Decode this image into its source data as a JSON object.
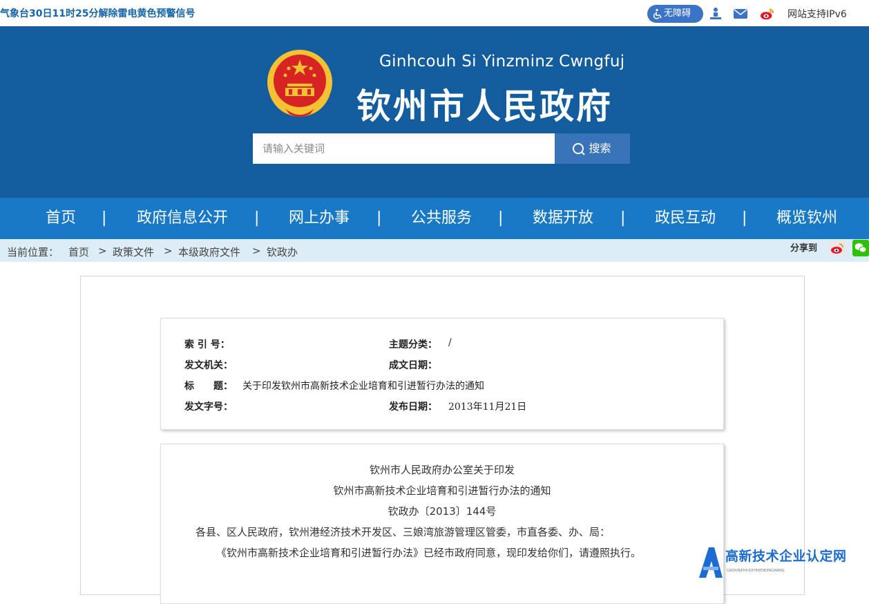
{
  "topbar": {
    "notice": "气象台30日11时25分解除雷电黄色预警信号",
    "accessibility_label": "无障碍",
    "ipv6_label": "网站支持IPv6"
  },
  "header": {
    "pinyin_title": "Ginhcouh Si Yinzminz Cwngfuj",
    "cn_title": "钦州市人民政府",
    "search_placeholder": "请输入关键词",
    "search_button": "搜索"
  },
  "nav": {
    "items": [
      "首页",
      "政府信息公开",
      "网上办事",
      "公共服务",
      "数据开放",
      "政民互动",
      "概览钦州"
    ],
    "separator": "|"
  },
  "breadcrumb": {
    "label": "当前位置：",
    "items": [
      "首页",
      "政策文件",
      "本级政府文件",
      "钦政办"
    ],
    "separator": ">",
    "share_label": "分享到"
  },
  "meta": {
    "index_label": "索 引 号：",
    "index_value": "",
    "topic_label": "主题分类：",
    "topic_value": "/",
    "issuer_label": "发文机关：",
    "issuer_value": "",
    "written_label": "成文日期：",
    "written_value": "",
    "title_label": "标　　题：",
    "title_value": "关于印发钦州市高新技术企业培育和引进暂行办法的通知",
    "docno_label": "发文字号：",
    "docno_value": "",
    "publish_label": "发布日期：",
    "publish_value": "2013年11月21日"
  },
  "document": {
    "heading_line1": "钦州市人民政府办公室关于印发",
    "heading_line2": "钦州市高新技术企业培育和引进暂行办法的通知",
    "doc_number": "钦政办〔2013〕144号",
    "recipients": "各县、区人民政府，钦州港经济技术开发区、三娘湾旅游管理区管委，市直各委、办、局：",
    "paragraph1": "《钦州市高新技术企业培育和引进暂行办法》已经市政府同意，现印发给你们，请遵照执行。"
  },
  "watermark": {
    "text": "高新技术企业认定网",
    "subtext": "GAOXINJISHUQIYERENDINGWANG"
  },
  "colors": {
    "header_bg": "#135c9d",
    "nav_bg": "#1a79c6",
    "breadcrumb_bg": "#dcedf7",
    "accent": "#3b74c6"
  }
}
